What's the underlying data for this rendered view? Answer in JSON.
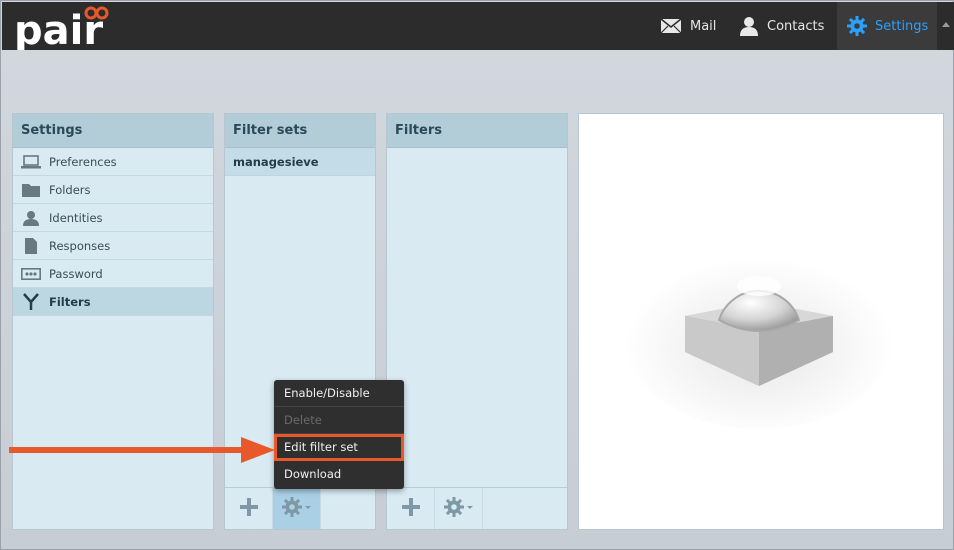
{
  "header": {
    "logo_text": "pair",
    "nav": [
      {
        "label": "Mail",
        "icon": "envelope-icon"
      },
      {
        "label": "Contacts",
        "icon": "person-icon"
      },
      {
        "label": "Settings",
        "icon": "gear-icon",
        "active": true
      }
    ]
  },
  "settings_panel": {
    "title": "Settings",
    "items": [
      {
        "label": "Preferences",
        "icon": "laptop-icon"
      },
      {
        "label": "Folders",
        "icon": "folder-icon"
      },
      {
        "label": "Identities",
        "icon": "person-icon"
      },
      {
        "label": "Responses",
        "icon": "document-icon"
      },
      {
        "label": "Password",
        "icon": "password-icon"
      },
      {
        "label": "Filters",
        "icon": "filter-icon",
        "selected": true
      }
    ]
  },
  "filter_sets_panel": {
    "title": "Filter sets",
    "items": [
      {
        "label": "managesieve"
      }
    ]
  },
  "filters_panel": {
    "title": "Filters"
  },
  "context_menu": {
    "items": [
      {
        "label": "Enable/Disable",
        "enabled": true
      },
      {
        "label": "Delete",
        "enabled": false
      },
      {
        "label": "Edit filter set",
        "enabled": true,
        "highlighted": true
      },
      {
        "label": "Download",
        "enabled": true
      }
    ]
  },
  "colors": {
    "accent": "#2aa0ff",
    "logo_accent": "#e8582a",
    "highlight_border": "#e8582a"
  }
}
